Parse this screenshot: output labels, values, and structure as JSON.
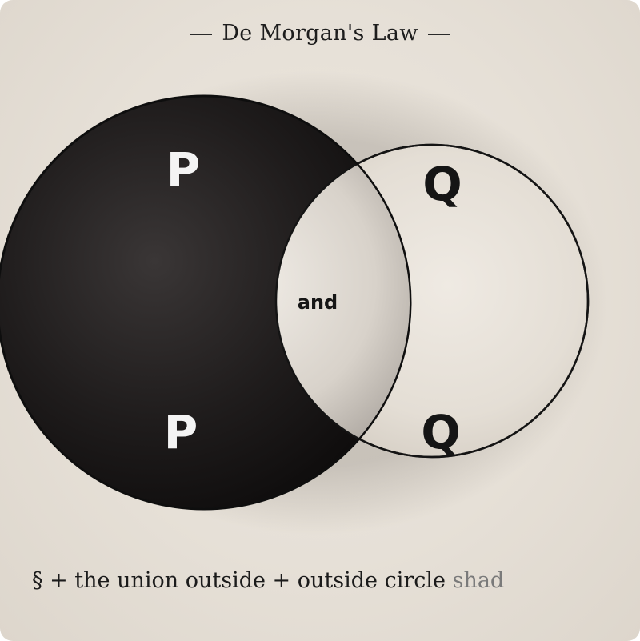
{
  "title": "De Morgan's Law",
  "labels": {
    "p_top": "P",
    "q_top": "Q",
    "center": "and",
    "p_bottom": "P",
    "q_bottom": "Q"
  },
  "caption": {
    "main": "§ + the union outside + outside circle",
    "faded": "shad"
  },
  "colors": {
    "background": "#e6e0d7",
    "left_circle": "#1c1a1a",
    "right_circle": "#e7e1d9",
    "outline": "#111111"
  }
}
